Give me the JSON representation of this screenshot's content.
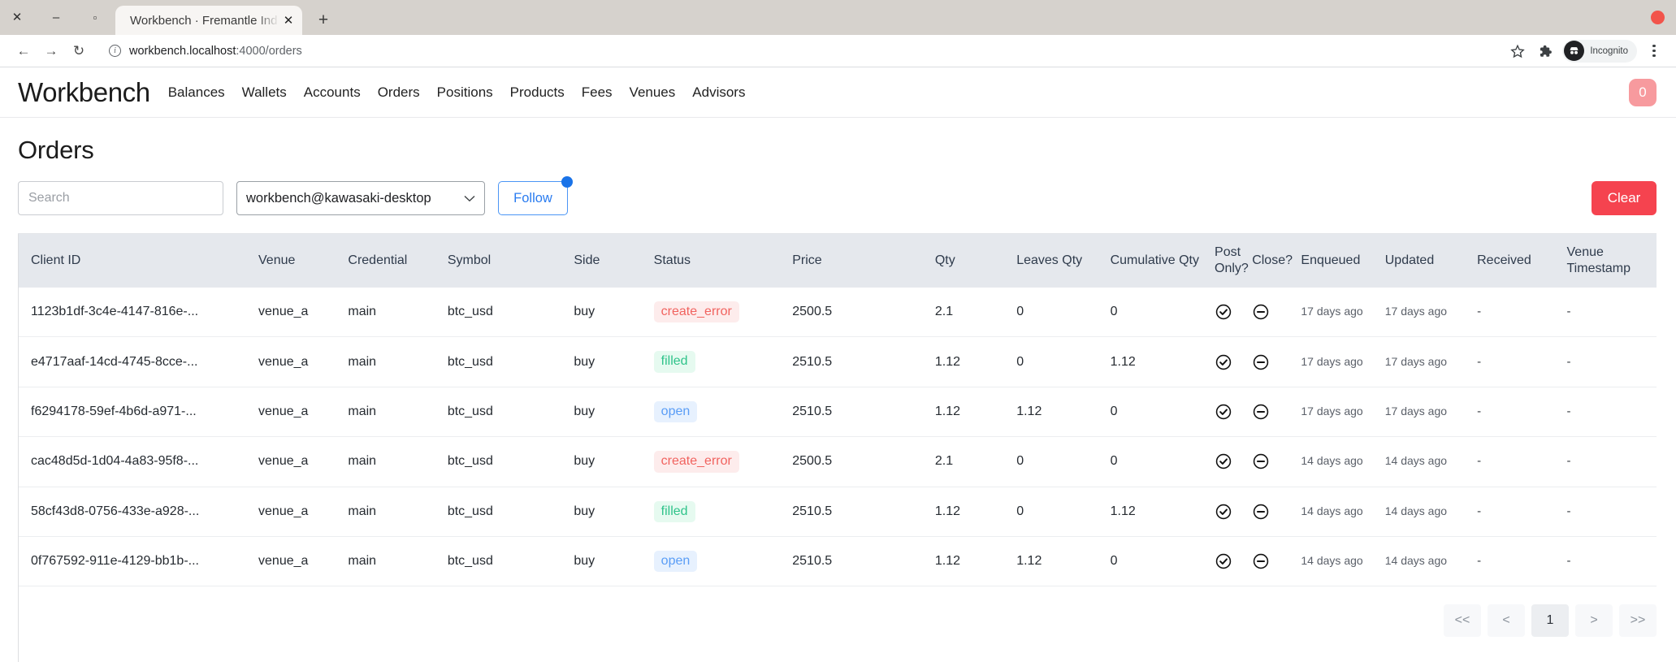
{
  "browser": {
    "window_controls": {
      "close": "✕",
      "minimize": "–",
      "maximize": "▫"
    },
    "tab": {
      "title": "Workbench · Fremantle Ind",
      "close": "✕"
    },
    "new_tab": "+",
    "nav": {
      "back": "←",
      "forward": "→",
      "reload": "↻"
    },
    "omnibox": {
      "info": "i",
      "url_host": "workbench.localhost",
      "url_path": ":4000/orders"
    },
    "profile": {
      "incognito_label": "Incognito"
    }
  },
  "appnav": {
    "brand": "Workbench",
    "links": [
      {
        "label": "Balances"
      },
      {
        "label": "Wallets"
      },
      {
        "label": "Accounts"
      },
      {
        "label": "Orders"
      },
      {
        "label": "Positions"
      },
      {
        "label": "Products"
      },
      {
        "label": "Fees"
      },
      {
        "label": "Venues"
      },
      {
        "label": "Advisors"
      }
    ],
    "badge_count": "0",
    "badge_color": "#f79a9e"
  },
  "page": {
    "title": "Orders"
  },
  "filters": {
    "search_placeholder": "Search",
    "search_value": "",
    "account_select_value": "workbench@kawasaki-desktop",
    "follow_label": "Follow",
    "clear_label": "Clear",
    "clear_color": "#f5434f",
    "follow_accent": "#2a7cf0"
  },
  "table": {
    "columns": [
      {
        "label": "Client ID"
      },
      {
        "label": "Venue"
      },
      {
        "label": "Credential"
      },
      {
        "label": "Symbol"
      },
      {
        "label": "Side"
      },
      {
        "label": "Status"
      },
      {
        "label": "Price"
      },
      {
        "label": "Qty"
      },
      {
        "label": "Leaves Qty"
      },
      {
        "label": "Cumulative Qty"
      },
      {
        "label": "Post Only?"
      },
      {
        "label": "Close?"
      },
      {
        "label": "Enqueued"
      },
      {
        "label": "Updated"
      },
      {
        "label": "Received"
      },
      {
        "label": "Venue Timestamp"
      }
    ],
    "rows": [
      {
        "client_id": "1123b1df-3c4e-4147-816e-...",
        "venue": "venue_a",
        "credential": "main",
        "symbol": "btc_usd",
        "side": "buy",
        "status": "create_error",
        "price": "2500.5",
        "qty": "2.1",
        "leaves_qty": "0",
        "cumulative_qty": "0",
        "post_only": "check-circle-icon",
        "close": "minus-circle-icon",
        "enqueued": "17 days ago",
        "updated": "17 days ago",
        "received": "-",
        "venue_timestamp": "-"
      },
      {
        "client_id": "e4717aaf-14cd-4745-8cce-...",
        "venue": "venue_a",
        "credential": "main",
        "symbol": "btc_usd",
        "side": "buy",
        "status": "filled",
        "price": "2510.5",
        "qty": "1.12",
        "leaves_qty": "0",
        "cumulative_qty": "1.12",
        "post_only": "check-circle-icon",
        "close": "minus-circle-icon",
        "enqueued": "17 days ago",
        "updated": "17 days ago",
        "received": "-",
        "venue_timestamp": "-"
      },
      {
        "client_id": "f6294178-59ef-4b6d-a971-...",
        "venue": "venue_a",
        "credential": "main",
        "symbol": "btc_usd",
        "side": "buy",
        "status": "open",
        "price": "2510.5",
        "qty": "1.12",
        "leaves_qty": "1.12",
        "cumulative_qty": "0",
        "post_only": "check-circle-icon",
        "close": "minus-circle-icon",
        "enqueued": "17 days ago",
        "updated": "17 days ago",
        "received": "-",
        "venue_timestamp": "-"
      },
      {
        "client_id": "cac48d5d-1d04-4a83-95f8-...",
        "venue": "venue_a",
        "credential": "main",
        "symbol": "btc_usd",
        "side": "buy",
        "status": "create_error",
        "price": "2500.5",
        "qty": "2.1",
        "leaves_qty": "0",
        "cumulative_qty": "0",
        "post_only": "check-circle-icon",
        "close": "minus-circle-icon",
        "enqueued": "14 days ago",
        "updated": "14 days ago",
        "received": "-",
        "venue_timestamp": "-"
      },
      {
        "client_id": "58cf43d8-0756-433e-a928-...",
        "venue": "venue_a",
        "credential": "main",
        "symbol": "btc_usd",
        "side": "buy",
        "status": "filled",
        "price": "2510.5",
        "qty": "1.12",
        "leaves_qty": "0",
        "cumulative_qty": "1.12",
        "post_only": "check-circle-icon",
        "close": "minus-circle-icon",
        "enqueued": "14 days ago",
        "updated": "14 days ago",
        "received": "-",
        "venue_timestamp": "-"
      },
      {
        "client_id": "0f767592-911e-4129-bb1b-...",
        "venue": "venue_a",
        "credential": "main",
        "symbol": "btc_usd",
        "side": "buy",
        "status": "open",
        "price": "2510.5",
        "qty": "1.12",
        "leaves_qty": "1.12",
        "cumulative_qty": "0",
        "post_only": "check-circle-icon",
        "close": "minus-circle-icon",
        "enqueued": "14 days ago",
        "updated": "14 days ago",
        "received": "-",
        "venue_timestamp": "-"
      }
    ],
    "status_colors": {
      "create_error_text": "#f1635f",
      "create_error_bg": "#fdecec",
      "filled_text": "#2fc38a",
      "filled_bg": "#e6faf0",
      "open_text": "#5a9df6",
      "open_bg": "#e7f1fe"
    }
  },
  "pagination": {
    "first": "<<",
    "prev": "<",
    "current": "1",
    "next": ">",
    "last": ">>"
  }
}
